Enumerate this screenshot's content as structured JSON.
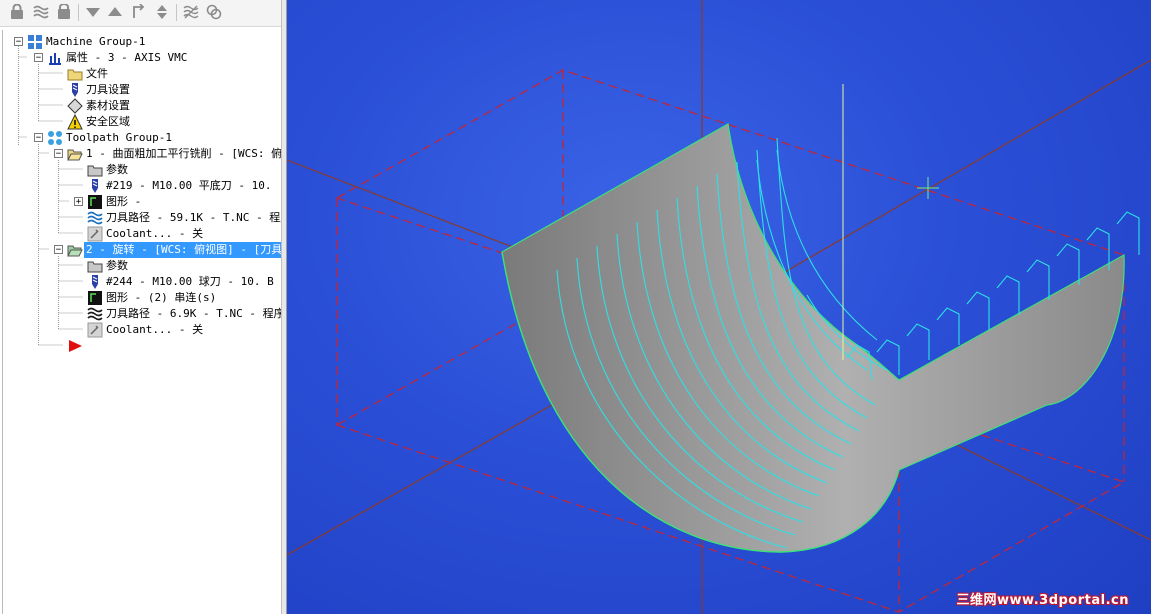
{
  "tree": {
    "machine_group": "Machine Group-1",
    "properties": "属性 - 3 - AXIS VMC",
    "files": "文件",
    "tool_settings": "刀具设置",
    "stock_settings": "素材设置",
    "safety_zone": "安全区域",
    "toolpath_group": "Toolpath Group-1",
    "op1": {
      "title": "1 - 曲面粗加工平行铣削 - [WCS: 俯",
      "params": "参数",
      "tool": "#219 - M10.00 平底刀 -    10.",
      "geometry": "图形 -",
      "toolpath": "刀具路径 - 59.1K - T.NC - 程序",
      "coolant": "Coolant... - 关"
    },
    "op2": {
      "title": "2 - 旋转 - [WCS: 俯视图] - [刀具",
      "params": "参数",
      "tool": "#244 - M10.00 球刀 -    10. B",
      "geometry": "图形 - (2) 串连(s)",
      "toolpath": "刀具路径 - 6.9K - T.NC - 程序",
      "coolant": "Coolant... - 关"
    }
  },
  "watermark": "三维网www.3dportal.cn",
  "colors": {
    "viewport_bg": "#2a4fd6",
    "surface": "#8e8e8e",
    "toolpath": "#2de0e6",
    "stock_box": "#c0263a",
    "selection": "#3399ff"
  },
  "icons": [
    "lock-icon",
    "toolpath-icon",
    "stock-icon",
    "arrow-down-icon",
    "arrow-up-icon",
    "return-icon",
    "updown-icon",
    "regen-icon",
    "verify-icon"
  ]
}
